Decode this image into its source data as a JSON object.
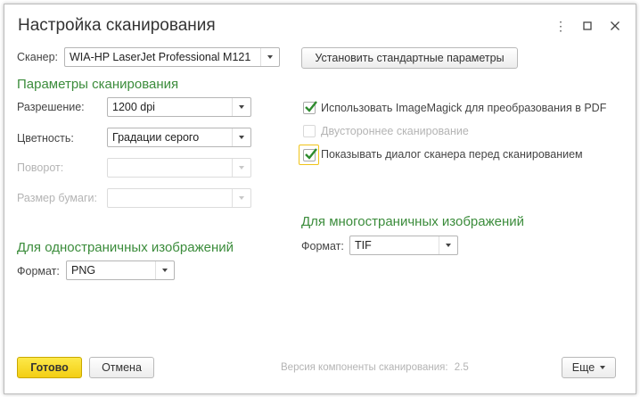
{
  "window": {
    "title": "Настройка сканирования"
  },
  "scanner": {
    "label": "Сканер:",
    "value": "WIA-HP LaserJet Professional M121"
  },
  "buttons": {
    "defaults": "Установить стандартные параметры",
    "ok": "Готово",
    "cancel": "Отмена",
    "more": "Еще"
  },
  "scan_params": {
    "heading": "Параметры сканирования",
    "resolution": {
      "label": "Разрешение:",
      "value": "1200 dpi"
    },
    "color": {
      "label": "Цветность:",
      "value": "Градации серого"
    },
    "rotation": {
      "label": "Поворот:",
      "value": ""
    },
    "paper": {
      "label": "Размер бумаги:",
      "value": ""
    }
  },
  "options": {
    "imagemagick": {
      "label": "Использовать ImageMagick для преобразования в PDF",
      "checked": true
    },
    "duplex": {
      "label": "Двустороннее сканирование",
      "checked": false
    },
    "show_dialog": {
      "label": "Показывать диалог сканера перед сканированием",
      "checked": true
    }
  },
  "single_page": {
    "heading": "Для одностраничных изображений",
    "format_label": "Формат:",
    "format_value": "PNG"
  },
  "multi_page": {
    "heading": "Для многостраничных изображений",
    "format_label": "Формат:",
    "format_value": "TIF"
  },
  "footer": {
    "version_label": "Версия компоненты сканирования:",
    "version_value": "2.5"
  },
  "colors": {
    "accent_green": "#3b8c3b",
    "primary_yellow": "#f3ce13",
    "check_green": "#2e8b2e"
  }
}
